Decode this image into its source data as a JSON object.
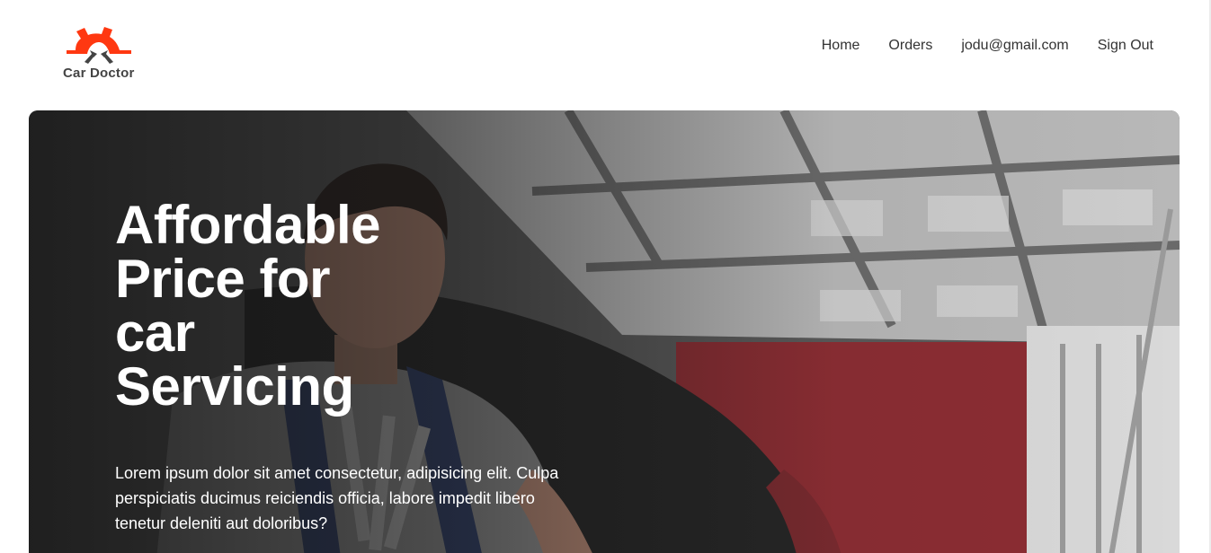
{
  "brand": {
    "name": "Car Doctor",
    "accent_color": "#FF3811"
  },
  "nav": {
    "items": [
      "Home",
      "Orders",
      "jodu@gmail.com",
      "Sign Out"
    ]
  },
  "hero": {
    "title": "Affordable Price for car Servicing",
    "description": "Lorem ipsum dolor sit amet consectetur, adipisicing elit. Culpa perspiciatis ducimus reiciendis officia, labore impedit libero tenetur deleniti aut doloribus?",
    "background_image": "mechanic-with-wrenches-in-garage"
  }
}
